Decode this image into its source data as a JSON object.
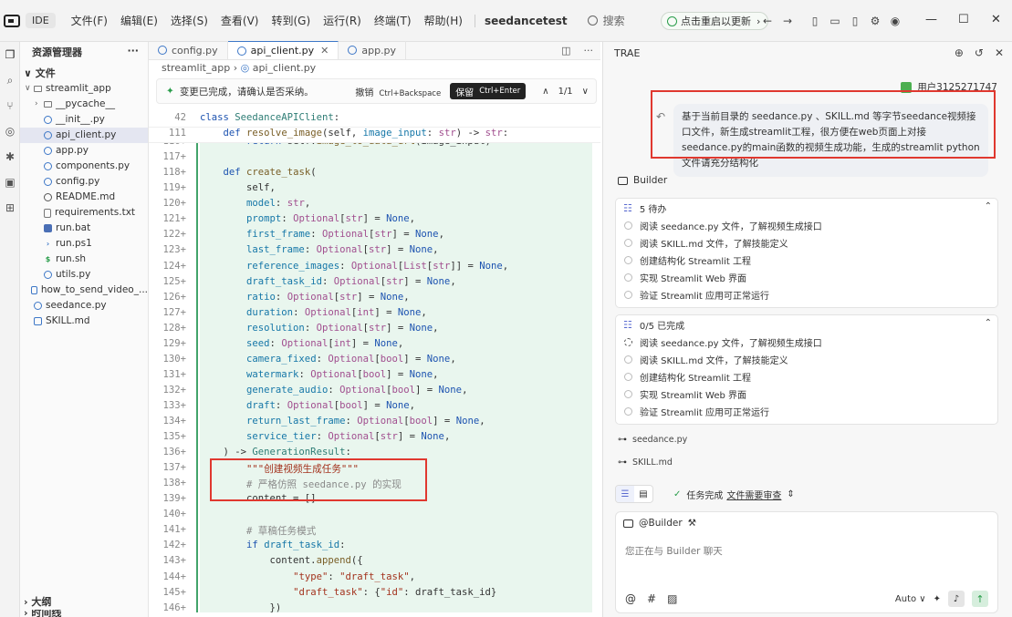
{
  "titlebar": {
    "mode": "IDE",
    "menu": [
      "文件(F)",
      "编辑(E)",
      "选择(S)",
      "查看(V)",
      "转到(G)",
      "运行(R)",
      "终端(T)",
      "帮助(H)"
    ],
    "project": "seedancetest",
    "search_placeholder": "搜索",
    "update_label": "点击重启以更新"
  },
  "explorer": {
    "title": "资源管理器",
    "section": "文件",
    "items": [
      {
        "label": "streamlit_app",
        "kind": "folder",
        "depth": 1,
        "arrow": "∨"
      },
      {
        "label": "__pycache__",
        "kind": "folder",
        "depth": 2,
        "arrow": "›"
      },
      {
        "label": "__init__.py",
        "kind": "py",
        "depth": 2,
        "arrow": ""
      },
      {
        "label": "api_client.py",
        "kind": "py",
        "depth": 2,
        "arrow": "",
        "selected": true
      },
      {
        "label": "app.py",
        "kind": "py",
        "depth": 2,
        "arrow": ""
      },
      {
        "label": "components.py",
        "kind": "py",
        "depth": 2,
        "arrow": ""
      },
      {
        "label": "config.py",
        "kind": "py",
        "depth": 2,
        "arrow": ""
      },
      {
        "label": "README.md",
        "kind": "info",
        "depth": 2,
        "arrow": ""
      },
      {
        "label": "requirements.txt",
        "kind": "txt",
        "depth": 2,
        "arrow": ""
      },
      {
        "label": "run.bat",
        "kind": "bat",
        "depth": 2,
        "arrow": ""
      },
      {
        "label": "run.ps1",
        "kind": "ps",
        "depth": 2,
        "arrow": ""
      },
      {
        "label": "run.sh",
        "kind": "sh",
        "depth": 2,
        "arrow": ""
      },
      {
        "label": "utils.py",
        "kind": "py",
        "depth": 2,
        "arrow": ""
      },
      {
        "label": "how_to_send_video_...",
        "kind": "md",
        "depth": 1,
        "arrow": ""
      },
      {
        "label": "seedance.py",
        "kind": "py",
        "depth": 1,
        "arrow": ""
      },
      {
        "label": "SKILL.md",
        "kind": "md",
        "depth": 1,
        "arrow": ""
      }
    ],
    "outline": "大纲",
    "timeline": "时间线"
  },
  "editor": {
    "tabs": [
      {
        "label": "config.py",
        "active": false
      },
      {
        "label": "api_client.py",
        "active": true
      },
      {
        "label": "app.py",
        "active": false
      }
    ],
    "breadcrumb": [
      "streamlit_app",
      "api_client.py"
    ],
    "changebar": {
      "message": "变更已完成，请确认是否采纳。",
      "undo": "撤销",
      "undo_kbd": "Ctrl+Backspace",
      "keep": "保留",
      "keep_kbd": "Ctrl+Enter",
      "counter": "1/1"
    },
    "sticky": [
      {
        "no": "42",
        "text": "class SeedanceAPIClient:"
      },
      {
        "no": "111",
        "text": "    def resolve_image(self, image_input: str) -> str:"
      }
    ],
    "lines": [
      {
        "no": "116+",
        "text": "        return self.image_to_data_url(image_input)"
      },
      {
        "no": "117+",
        "text": ""
      },
      {
        "no": "118+",
        "text": "    def create_task("
      },
      {
        "no": "119+",
        "text": "        self,"
      },
      {
        "no": "120+",
        "text": "        model: str,"
      },
      {
        "no": "121+",
        "text": "        prompt: Optional[str] = None,"
      },
      {
        "no": "122+",
        "text": "        first_frame: Optional[str] = None,"
      },
      {
        "no": "123+",
        "text": "        last_frame: Optional[str] = None,"
      },
      {
        "no": "124+",
        "text": "        reference_images: Optional[List[str]] = None,"
      },
      {
        "no": "125+",
        "text": "        draft_task_id: Optional[str] = None,"
      },
      {
        "no": "126+",
        "text": "        ratio: Optional[str] = None,"
      },
      {
        "no": "127+",
        "text": "        duration: Optional[int] = None,"
      },
      {
        "no": "128+",
        "text": "        resolution: Optional[str] = None,"
      },
      {
        "no": "129+",
        "text": "        seed: Optional[int] = None,"
      },
      {
        "no": "130+",
        "text": "        camera_fixed: Optional[bool] = None,"
      },
      {
        "no": "131+",
        "text": "        watermark: Optional[bool] = None,"
      },
      {
        "no": "132+",
        "text": "        generate_audio: Optional[bool] = None,"
      },
      {
        "no": "133+",
        "text": "        draft: Optional[bool] = None,"
      },
      {
        "no": "134+",
        "text": "        return_last_frame: Optional[bool] = None,"
      },
      {
        "no": "135+",
        "text": "        service_tier: Optional[str] = None,"
      },
      {
        "no": "136+",
        "text": "    ) -> GenerationResult:"
      },
      {
        "no": "137+",
        "text": "        \"\"\"创建视频生成任务\"\"\""
      },
      {
        "no": "138+",
        "text": "        # 严格仿照 seedance.py 的实现"
      },
      {
        "no": "139+",
        "text": "        content = []"
      },
      {
        "no": "140+",
        "text": ""
      },
      {
        "no": "141+",
        "text": "        # 草稿任务模式"
      },
      {
        "no": "142+",
        "text": "        if draft_task_id:"
      },
      {
        "no": "143+",
        "text": "            content.append({"
      },
      {
        "no": "144+",
        "text": "                \"type\": \"draft_task\","
      },
      {
        "no": "145+",
        "text": "                \"draft_task\": {\"id\": draft_task_id}"
      },
      {
        "no": "146+",
        "text": "            })"
      }
    ]
  },
  "panel": {
    "title": "TRAE",
    "user": "用户3125271747",
    "message": "基于当前目录的 seedance.py 、SKILL.md 等字节seedance视频接口文件，新生成streamlit工程，很方便在web页面上对接seedance.py的main函数的视频生成功能，生成的streamlit python文件请充分结构化",
    "builder_label": "Builder",
    "todo_card": {
      "header": "5 待办",
      "items": [
        "阅读 seedance.py 文件，了解视频生成接口",
        "阅读 SKILL.md 文件，了解技能定义",
        "创建结构化 Streamlit 工程",
        "实现 Streamlit Web 界面",
        "验证 Streamlit 应用可正常运行"
      ]
    },
    "progress_card": {
      "header": "0/5 已完成",
      "items": [
        "阅读 seedance.py 文件，了解视频生成接口",
        "阅读 SKILL.md 文件，了解技能定义",
        "创建结构化 Streamlit 工程",
        "实现 Streamlit Web 界面",
        "验证 Streamlit 应用可正常运行"
      ]
    },
    "files": [
      "seedance.py",
      "SKILL.md"
    ],
    "status": {
      "label": "任务完成",
      "review": "文件需要审查"
    },
    "input": {
      "chip": "@Builder",
      "placeholder": "您正在与 Builder 聊天",
      "model": "Auto"
    }
  }
}
